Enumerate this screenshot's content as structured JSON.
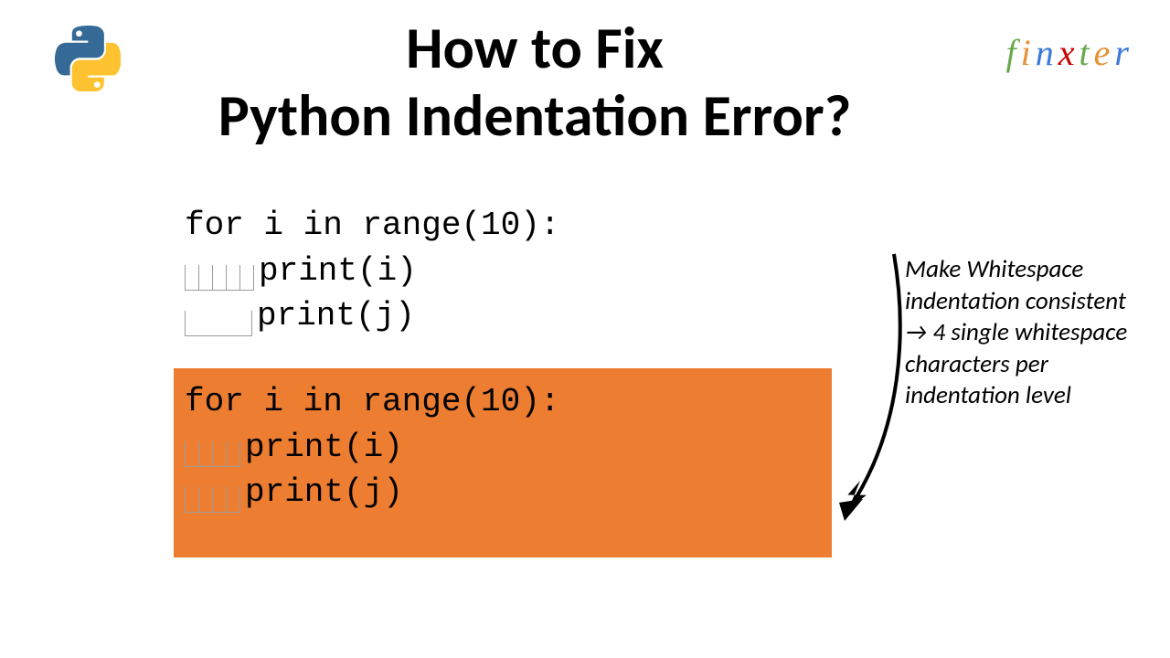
{
  "brand": {
    "letters": [
      {
        "ch": "f",
        "color": "#6aa84f"
      },
      {
        "ch": "i",
        "color": "#e69138"
      },
      {
        "ch": "n",
        "color": "#3c78d8"
      },
      {
        "ch": "x",
        "color": "#cc0000"
      },
      {
        "ch": "t",
        "color": "#6aa84f"
      },
      {
        "ch": "e",
        "color": "#e69138"
      },
      {
        "ch": "r",
        "color": "#3c78d8"
      }
    ]
  },
  "title": {
    "line1": "How to Fix",
    "line2": "Python Indentation Error?"
  },
  "code": {
    "bad": {
      "line1": "for i in range(10):",
      "line2": "print(i)",
      "line3": "print(j)",
      "ws2": 5,
      "ws3_tab": 1
    },
    "good": {
      "line1": "for i in range(10):",
      "line2": "print(i)",
      "line3": "print(j)",
      "ws": 4
    }
  },
  "annotation": "Make Whitespace indentation consistent → 4 single whitespace characters per indentation level"
}
